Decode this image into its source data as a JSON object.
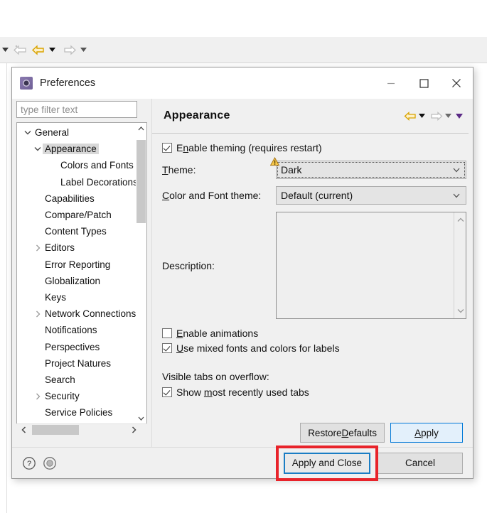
{
  "ide_toolbar": {
    "items": [
      {
        "name": "caret-left-edge",
        "icon": "caret-down"
      },
      {
        "name": "back-arrow-disabled",
        "icon": "arrow-left-outline-disabled"
      },
      {
        "name": "back-arrow",
        "icon": "arrow-left-gold"
      },
      {
        "name": "back-dropdown",
        "icon": "caret-down"
      },
      {
        "name": "forward-arrow",
        "icon": "arrow-right-outline"
      },
      {
        "name": "forward-dropdown",
        "icon": "caret-down"
      }
    ]
  },
  "dialog": {
    "title": "Preferences",
    "icon": "preferences-gear-icon",
    "window_buttons": [
      {
        "name": "minimize",
        "glyph": "minimize"
      },
      {
        "name": "maximize",
        "glyph": "maximize"
      },
      {
        "name": "close",
        "glyph": "close"
      }
    ]
  },
  "filter": {
    "placeholder": "type filter text",
    "value": ""
  },
  "tree": {
    "items": [
      {
        "label": "General",
        "indent": 0,
        "twisty": "expanded",
        "selected": false
      },
      {
        "label": "Appearance",
        "indent": 1,
        "twisty": "expanded",
        "selected": true
      },
      {
        "label": "Colors and Fonts",
        "indent": 2,
        "twisty": "none",
        "selected": false
      },
      {
        "label": "Label Decorations",
        "indent": 2,
        "twisty": "none",
        "selected": false
      },
      {
        "label": "Capabilities",
        "indent": 1,
        "twisty": "none",
        "selected": false
      },
      {
        "label": "Compare/Patch",
        "indent": 1,
        "twisty": "none",
        "selected": false
      },
      {
        "label": "Content Types",
        "indent": 1,
        "twisty": "none",
        "selected": false
      },
      {
        "label": "Editors",
        "indent": 1,
        "twisty": "collapsed",
        "selected": false
      },
      {
        "label": "Error Reporting",
        "indent": 1,
        "twisty": "none",
        "selected": false
      },
      {
        "label": "Globalization",
        "indent": 1,
        "twisty": "none",
        "selected": false
      },
      {
        "label": "Keys",
        "indent": 1,
        "twisty": "none",
        "selected": false
      },
      {
        "label": "Network Connections",
        "indent": 1,
        "twisty": "collapsed",
        "selected": false
      },
      {
        "label": "Notifications",
        "indent": 1,
        "twisty": "none",
        "selected": false
      },
      {
        "label": "Perspectives",
        "indent": 1,
        "twisty": "none",
        "selected": false
      },
      {
        "label": "Project Natures",
        "indent": 1,
        "twisty": "none",
        "selected": false
      },
      {
        "label": "Search",
        "indent": 1,
        "twisty": "none",
        "selected": false
      },
      {
        "label": "Security",
        "indent": 1,
        "twisty": "collapsed",
        "selected": false
      },
      {
        "label": "Service Policies",
        "indent": 1,
        "twisty": "none",
        "selected": false
      }
    ]
  },
  "page": {
    "title": "Appearance",
    "nav": [
      {
        "name": "back-arrow",
        "icon": "arrow-left-gold"
      },
      {
        "name": "back-dropdown",
        "icon": "caret-down-black"
      },
      {
        "name": "forward-arrow",
        "icon": "arrow-right-outline"
      },
      {
        "name": "forward-dropdown",
        "icon": "caret-down-grey"
      },
      {
        "name": "view-menu",
        "icon": "caret-down-purple"
      }
    ],
    "enable_theming": {
      "label_pre": "E",
      "label_mnemonic": "n",
      "label_post": "able theming (requires restart)",
      "label": "Enable theming (requires restart)",
      "checked": true
    },
    "theme": {
      "label": "Theme:",
      "label_mnemonic": "T",
      "label_post": "heme:",
      "value": "Dark",
      "has_warning": true,
      "focused": true
    },
    "color_font_theme": {
      "label_mnemonic": "C",
      "label_post": "olor and Font theme:",
      "label": "Color and Font theme:",
      "value": "Default (current)"
    },
    "description": {
      "label": "Description:",
      "value": ""
    },
    "enable_animations": {
      "label_pre": "",
      "label_mnemonic": "E",
      "label_post": "nable animations",
      "label": "Enable animations",
      "checked": false
    },
    "mixed_fonts": {
      "label_mnemonic": "U",
      "label_post": "se mixed fonts and colors for labels",
      "label": "Use mixed fonts and colors for labels",
      "checked": true
    },
    "visible_tabs_label": "Visible tabs on overflow:",
    "show_mru": {
      "label_pre": "Show ",
      "label_mnemonic": "m",
      "label_post": "ost recently used tabs",
      "label": "Show most recently used tabs",
      "checked": true
    },
    "restore_defaults": {
      "label_pre": "Restore ",
      "label_mnemonic": "D",
      "label_post": "efaults",
      "label": "Restore Defaults"
    },
    "apply": {
      "label_pre": "",
      "label_mnemonic": "A",
      "label_post": "pply",
      "label": "Apply",
      "focused": true
    }
  },
  "bottom": {
    "help_icon": "help-question-icon",
    "secondary_icon": "record-circle-icon",
    "apply_and_close": {
      "label": "Apply and Close",
      "focused": true,
      "annotated": true
    },
    "cancel": {
      "label": "Cancel"
    }
  },
  "colors": {
    "accent_blue": "#0078d7",
    "annotation_red": "#e8232a",
    "gold_arrow": "#d9a300",
    "dialog_bg": "#f0f0f0",
    "selection_grey": "#d8d8d8"
  }
}
